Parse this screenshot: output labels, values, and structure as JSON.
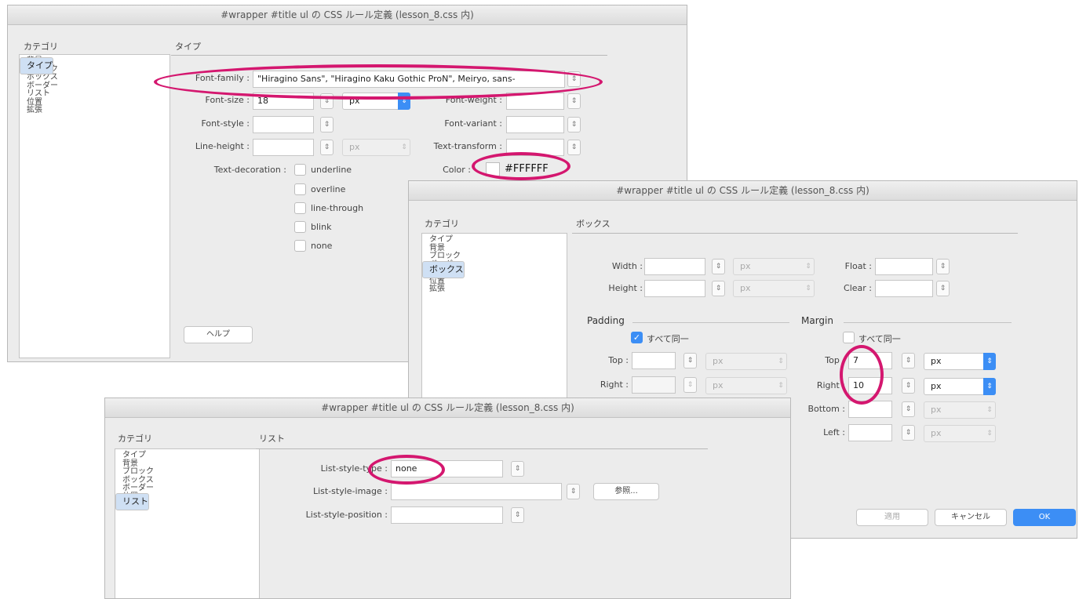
{
  "dialog_type": {
    "title": "#wrapper #title ul の CSS ルール定義 (lesson_8.css 内)",
    "category_label": "カテゴリ",
    "categories": [
      "タイプ",
      "背景",
      "ブロック",
      "ボックス",
      "ボーダー",
      "リスト",
      "位置",
      "拡張"
    ],
    "selected_category": "タイプ",
    "section_title": "タイプ",
    "font_family_label": "Font-family :",
    "font_family_value": "\"Hiragino Sans\", \"Hiragino Kaku Gothic ProN\", Meiryo, sans-",
    "font_size_label": "Font-size :",
    "font_size_value": "18",
    "font_size_unit": "px",
    "font_weight_label": "Font-weight :",
    "font_style_label": "Font-style :",
    "font_variant_label": "Font-variant :",
    "line_height_label": "Line-height :",
    "line_height_unit": "px",
    "text_transform_label": "Text-transform :",
    "text_decoration_label": "Text-decoration :",
    "decorations": [
      "underline",
      "overline",
      "line-through",
      "blink",
      "none"
    ],
    "color_label": "Color :",
    "color_value": "#FFFFFF",
    "help_button": "ヘルプ"
  },
  "dialog_box": {
    "title": "#wrapper #title ul の CSS ルール定義 (lesson_8.css 内)",
    "category_label": "カテゴリ",
    "categories": [
      "タイプ",
      "背景",
      "ブロック",
      "ボックス",
      "ボーダー",
      "リスト",
      "位置",
      "拡張"
    ],
    "selected_category": "ボックス",
    "section_title": "ボックス",
    "width_label": "Width :",
    "height_label": "Height :",
    "float_label": "Float :",
    "clear_label": "Clear :",
    "unit_px": "px",
    "padding_label": "Padding",
    "padding_same_label": "すべて同一",
    "padding_same_checked": true,
    "margin_label": "Margin",
    "margin_same_label": "すべて同一",
    "margin_same_checked": false,
    "top_label": "Top :",
    "right_label": "Right :",
    "bottom_label": "Bottom :",
    "left_label": "Left :",
    "margin_top_value": "7",
    "margin_right_value": "10",
    "apply_button": "適用",
    "cancel_button": "キャンセル",
    "ok_button": "OK"
  },
  "dialog_list": {
    "title": "#wrapper #title ul の CSS ルール定義 (lesson_8.css 内)",
    "category_label": "カテゴリ",
    "categories": [
      "タイプ",
      "背景",
      "ブロック",
      "ボックス",
      "ボーダー",
      "リスト",
      "位置",
      "拡張"
    ],
    "selected_category": "リスト",
    "section_title": "リスト",
    "list_style_type_label": "List-style-type :",
    "list_style_type_value": "none",
    "list_style_image_label": "List-style-image :",
    "browse_button": "参照...",
    "list_style_position_label": "List-style-position :"
  },
  "colors": {
    "highlight_oval": "#d4176f",
    "accent_blue": "#3c8ef5"
  }
}
